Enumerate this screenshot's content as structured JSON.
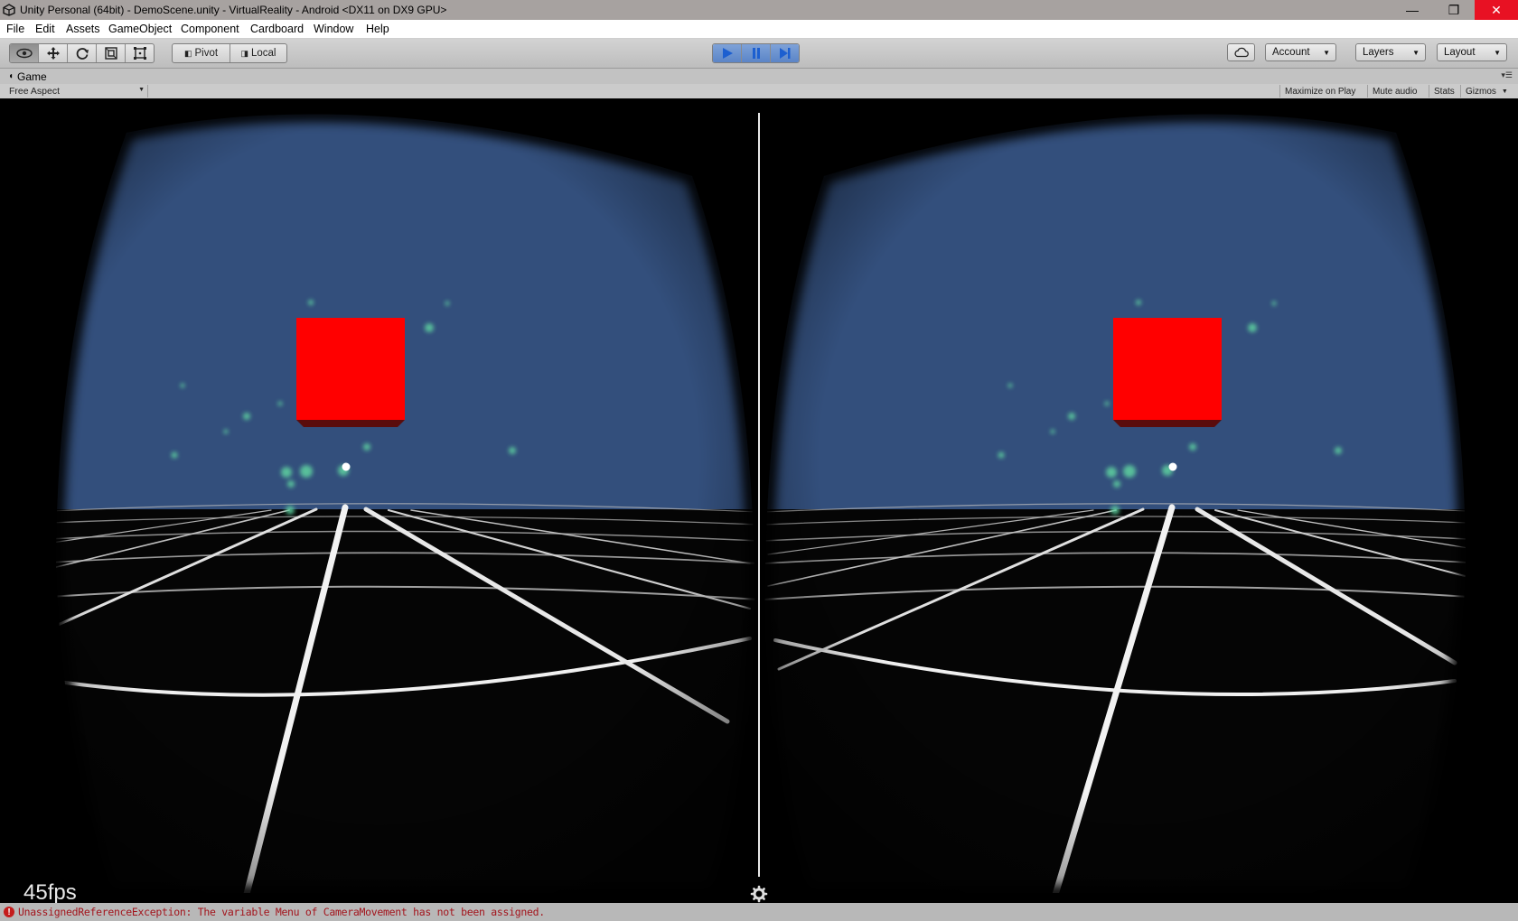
{
  "window": {
    "title": "Unity Personal (64bit) - DemoScene.unity - VirtualReality - Android <DX11 on DX9 GPU>",
    "minimize": "—",
    "restore": "❐",
    "close": "✕"
  },
  "menu": [
    "File",
    "Edit",
    "Assets",
    "GameObject",
    "Component",
    "Cardboard",
    "Window",
    "Help"
  ],
  "toolbar": {
    "pivot_label": "Pivot",
    "local_label": "Local",
    "account_label": "Account",
    "layers_label": "Layers",
    "layout_label": "Layout",
    "play_state": "playing"
  },
  "game_view": {
    "tab_label": "Game",
    "aspect_label": "Free Aspect",
    "maximize_label": "Maximize on Play",
    "mute_label": "Mute audio",
    "stats_label": "Stats",
    "gizmos_label": "Gizmos",
    "fps_text": "45fps"
  },
  "status": {
    "message": "UnassignedReferenceException: The variable Menu of CameraMovement has not been assigned."
  },
  "colors": {
    "sky": "#334f7c",
    "cube": "#ff0000",
    "play_accent": "#2a6fd6",
    "error_text": "#a3141c"
  }
}
